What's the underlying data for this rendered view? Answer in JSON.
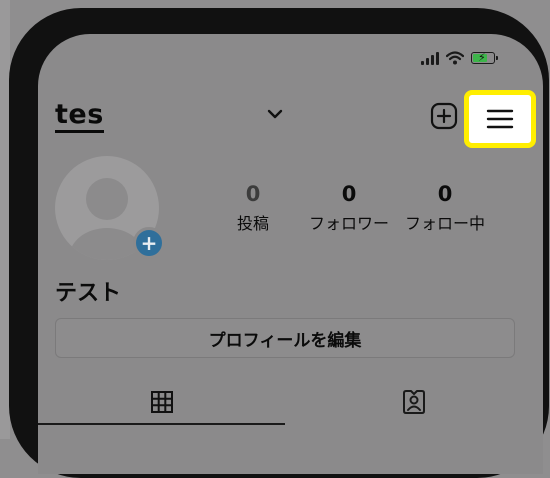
{
  "profile": {
    "username": "tes",
    "display_name": "テスト",
    "edit_button_label": "プロフィールを編集"
  },
  "stats": [
    {
      "value": "0",
      "label": "投稿"
    },
    {
      "value": "0",
      "label": "フォロワー"
    },
    {
      "value": "0",
      "label": "フォロー中"
    }
  ],
  "icons": {
    "account_switch": "chevron-down-icon",
    "new_post": "plus-square-icon",
    "menu": "hamburger-menu-icon",
    "add_story": "plus-icon",
    "grid_tab": "grid-icon",
    "tagged_tab": "tagged-person-icon",
    "signal": "cellular-signal-icon",
    "wifi": "wifi-icon",
    "battery": "battery-charging-icon"
  },
  "colors": {
    "highlight": "#ffee00",
    "add_story_badge": "#2f6f9b",
    "battery_fill": "#3db54a"
  }
}
